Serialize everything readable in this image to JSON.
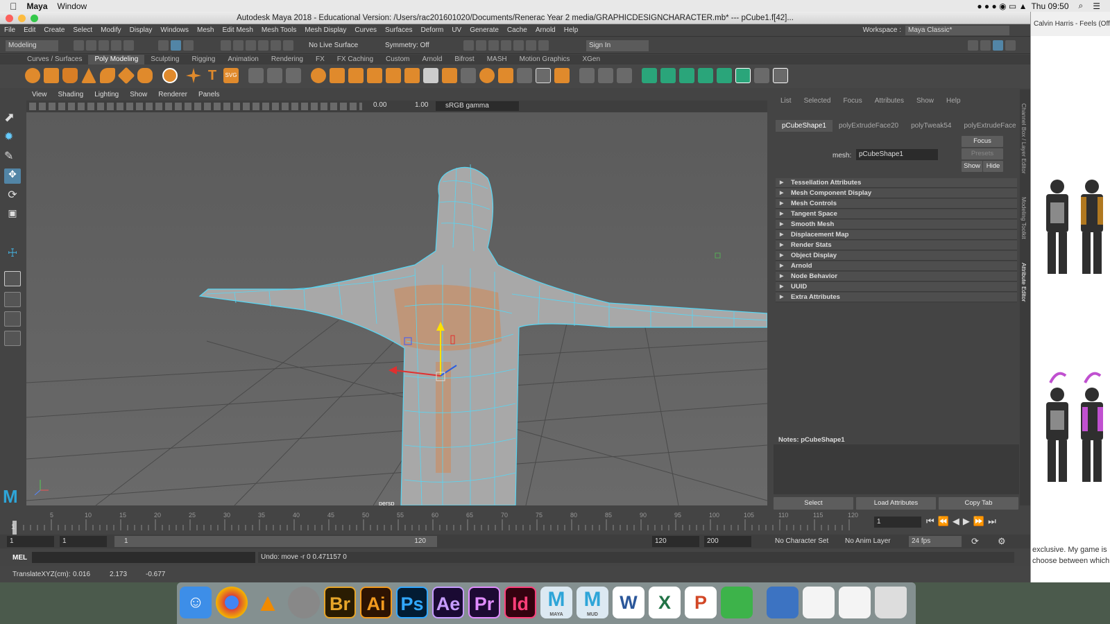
{
  "macbar": {
    "app": "Maya",
    "menu": [
      "Window"
    ],
    "time": "Thu 09:50"
  },
  "window": {
    "title": "Autodesk Maya 2018 - Educational Version: /Users/rac201601020/Documents/Renerac Year 2 media/GRAPHICDESIGNCHARACTER.mb*   ---   pCube1.f[42]..."
  },
  "menus": [
    "File",
    "Edit",
    "Create",
    "Select",
    "Modify",
    "Display",
    "Windows",
    "Mesh",
    "Edit Mesh",
    "Mesh Tools",
    "Mesh Display",
    "Curves",
    "Surfaces",
    "Deform",
    "UV",
    "Generate",
    "Cache",
    "Arnold",
    "Help"
  ],
  "workspace": {
    "label": "Workspace :",
    "value": "Maya Classic*"
  },
  "status": {
    "mode": "Modeling",
    "live": "No Live Surface",
    "symmetry": "Symmetry: Off",
    "signin": "Sign In"
  },
  "shelf_tabs": [
    "Curves / Surfaces",
    "Poly Modeling",
    "Sculpting",
    "Rigging",
    "Animation",
    "Rendering",
    "FX",
    "FX Caching",
    "Custom",
    "Arnold",
    "Bifrost",
    "MASH",
    "Motion Graphics",
    "XGen"
  ],
  "viewport": {
    "menus": [
      "View",
      "Shading",
      "Lighting",
      "Show",
      "Renderer",
      "Panels"
    ],
    "val1": "0.00",
    "val2": "1.00",
    "colorspace": "sRGB gamma",
    "camera": "persp"
  },
  "attr": {
    "menus": [
      "List",
      "Selected",
      "Focus",
      "Attributes",
      "Show",
      "Help"
    ],
    "tabs": [
      "pCubeShape1",
      "polyExtrudeFace20",
      "polyTweak54",
      "polyExtrudeFace"
    ],
    "mesh_label": "mesh:",
    "mesh_value": "pCubeShape1",
    "focus": "Focus",
    "presets": "Presets",
    "show": "Show",
    "hide": "Hide",
    "sections": [
      "Tessellation Attributes",
      "Mesh Component Display",
      "Mesh Controls",
      "Tangent Space",
      "Smooth Mesh",
      "Displacement Map",
      "Render Stats",
      "Object Display",
      "Arnold",
      "Node Behavior",
      "UUID",
      "Extra Attributes"
    ],
    "notes": "Notes:  pCubeShape1",
    "select": "Select",
    "load": "Load Attributes",
    "copy": "Copy Tab"
  },
  "side_tabs": [
    "Channel Box / Layer Editor",
    "Modeling Toolkit",
    "Attribute Editor"
  ],
  "timeline": {
    "ticks": [
      "5",
      "10",
      "15",
      "20",
      "25",
      "30",
      "35",
      "40",
      "45",
      "50",
      "55",
      "60",
      "65",
      "70",
      "75",
      "80",
      "85",
      "90",
      "95",
      "100",
      "105",
      "110",
      "115",
      "120"
    ],
    "start_tick": "1",
    "current": "1"
  },
  "range": {
    "start": "1",
    "start2": "1",
    "slider_start": "1",
    "slider_end": "120",
    "end": "120",
    "end2": "200",
    "charset": "No Character Set",
    "animlayer": "No Anim Layer",
    "fps": "24 fps"
  },
  "cmd": {
    "lang": "MEL",
    "result": "Undo: move -r 0 0.471157 0"
  },
  "help": {
    "label": "TranslateXYZ(cm):",
    "x": "0.016",
    "y": "2.173",
    "z": "-0.677"
  },
  "rightwin": {
    "title": "Calvin Harris - Feels (Off",
    "text1": "exclusive. My game is",
    "text2": "choose between which"
  },
  "dock": [
    {
      "label": "Br",
      "color": "#2a1c02",
      "fg": "#e6a52a"
    },
    {
      "label": "Ai",
      "color": "#2d1302",
      "fg": "#f29a1e"
    },
    {
      "label": "Ps",
      "color": "#021c33",
      "fg": "#31a8ff"
    },
    {
      "label": "Ae",
      "color": "#1a0a33",
      "fg": "#c79dff"
    },
    {
      "label": "Pr",
      "color": "#1d0a33",
      "fg": "#e08cff"
    },
    {
      "label": "Id",
      "color": "#33020f",
      "fg": "#ff3f7a"
    }
  ],
  "dock_labels": {
    "maya": "MAYA",
    "mud": "MUD"
  }
}
